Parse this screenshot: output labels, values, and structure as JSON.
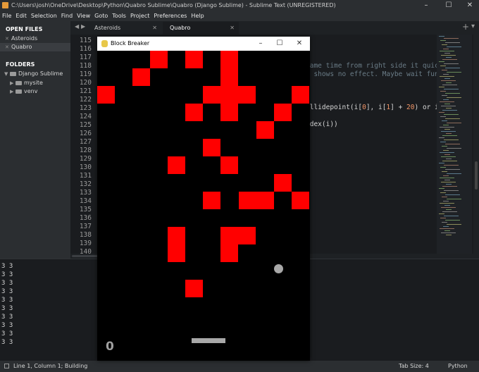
{
  "window": {
    "title": "C:\\Users\\josh\\OneDrive\\Desktop\\Python\\Quabro Sublime\\Quabro (Django Sublime) - Sublime Text (UNREGISTERED)",
    "minimize": "–",
    "maximize": "☐",
    "close": "✕"
  },
  "menu": [
    "File",
    "Edit",
    "Selection",
    "Find",
    "View",
    "Goto",
    "Tools",
    "Project",
    "Preferences",
    "Help"
  ],
  "sidebar": {
    "open_files_heading": "OPEN FILES",
    "open_files": [
      "Asteroids",
      "Quabro"
    ],
    "folders_heading": "FOLDERS",
    "root_folder": "Django Sublime",
    "subfolders": [
      "mysite",
      "venv"
    ],
    "close_glyph": "✕",
    "expand_glyph": "▶",
    "collapse_glyph": "▼"
  },
  "tabs": {
    "nav_left": "◀",
    "nav_right": "▶",
    "items": [
      {
        "label": "Asteroids",
        "active": false
      },
      {
        "label": "Quabro",
        "active": true
      }
    ],
    "close_glyph": "✕",
    "add": "+",
    "dropdown": "▾"
  },
  "editor": {
    "line_numbers": [
      "115",
      "116",
      "117",
      "118",
      "119",
      "120",
      "121",
      "122",
      "123",
      "124",
      "125",
      "126",
      "127",
      "128",
      "129",
      "130",
      "131",
      "132",
      "133",
      "134",
      "135",
      "136",
      "137",
      "138",
      "139",
      "140"
    ],
    "fragments": [
      {
        "text": "same time from right side it quic"
      },
      {
        "text": "d shows no effect. Maybe wait fun"
      },
      {
        "pre": "ollidepoint(i[",
        "n1": "0",
        "mid": "], i[",
        "n2": "1",
        "post": "] + ",
        "n3": "20",
        "end": ") or i"
      },
      {
        "text": "ndex(i))"
      }
    ]
  },
  "console": {
    "lines": [
      "3 3",
      "3 3",
      "3 3",
      "3 3",
      "3 3",
      "3 3",
      "3 3",
      "3 3",
      "3 3",
      "3 3"
    ]
  },
  "status": {
    "position": "Line 1, Column 1; Building",
    "tab_size": "Tab Size: 4",
    "syntax": "Python"
  },
  "game": {
    "title": "Block Breaker",
    "minimize": "–",
    "maximize": "☐",
    "close": "✕",
    "score": "0",
    "block_color": "#ff0000",
    "ball_color": "#a8a8a8",
    "background": "#000000"
  }
}
